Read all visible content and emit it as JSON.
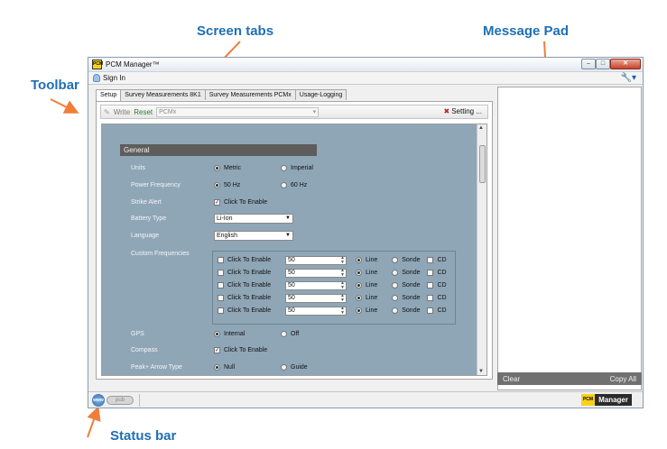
{
  "annotations": {
    "screen_tabs": "Screen tabs",
    "message_pad": "Message Pad",
    "toolbar": "Toolbar",
    "status_bar": "Status bar"
  },
  "window": {
    "title": "PCM Manager™",
    "logo_text": "PCM",
    "controls": {
      "minimize": "–",
      "maximize": "□",
      "close": "✕"
    }
  },
  "signin": {
    "label": "Sign In"
  },
  "tabs": [
    {
      "label": "Setup",
      "active": true
    },
    {
      "label": "Survey Measurements 8K1",
      "active": false
    },
    {
      "label": "Survey Measurements PCMx",
      "active": false
    },
    {
      "label": "Usage-Logging",
      "active": false
    }
  ],
  "toolbar": {
    "write": "Write",
    "reset": "Reset",
    "device_select": "PCMx",
    "setting": "Setting ..."
  },
  "form": {
    "section": "General",
    "units": {
      "label": "Units",
      "options": [
        "Metric",
        "Imperial"
      ],
      "selected": "Metric"
    },
    "power_frequency": {
      "label": "Power Frequency",
      "options": [
        "50 Hz",
        "60 Hz"
      ],
      "selected": "50 Hz"
    },
    "strike_alert": {
      "label": "Strike Alert",
      "checkbox": "Click To Enable",
      "checked": true
    },
    "battery_type": {
      "label": "Battery Type",
      "value": "Li-Ion"
    },
    "language": {
      "label": "Language",
      "value": "English"
    },
    "custom_frequencies": {
      "label": "Custom Frequencies",
      "rows": [
        {
          "enable": "Click To Enable",
          "value": "50",
          "line": "Line",
          "sonde": "Sonde",
          "cd": "CD"
        },
        {
          "enable": "Click To Enable",
          "value": "50",
          "line": "Line",
          "sonde": "Sonde",
          "cd": "CD"
        },
        {
          "enable": "Click To Enable",
          "value": "50",
          "line": "Line",
          "sonde": "Sonde",
          "cd": "CD"
        },
        {
          "enable": "Click To Enable",
          "value": "50",
          "line": "Line",
          "sonde": "Sonde",
          "cd": "CD"
        },
        {
          "enable": "Click To Enable",
          "value": "50",
          "line": "Line",
          "sonde": "Sonde",
          "cd": "CD"
        }
      ]
    },
    "gps": {
      "label": "GPS",
      "options": [
        "Internal",
        "Off"
      ],
      "selected": "Internal"
    },
    "compass": {
      "label": "Compass",
      "checkbox": "Click To Enable",
      "checked": true
    },
    "peak_arrow_type": {
      "label": "Peak+ Arrow Type",
      "options": [
        "Null",
        "Guide"
      ],
      "selected": "Null"
    }
  },
  "message_pad": {
    "clear": "Clear",
    "copy_all": "Copy All"
  },
  "status_bar": {
    "www": "www",
    "pub": "pub",
    "brand_pcm": "PCM",
    "brand_manager": "Manager"
  },
  "colors": {
    "annotation": "#1f6fb5",
    "arrow": "#f07e3a",
    "form_bg": "#8fa6b7",
    "section_bar": "#5d5d5d"
  }
}
